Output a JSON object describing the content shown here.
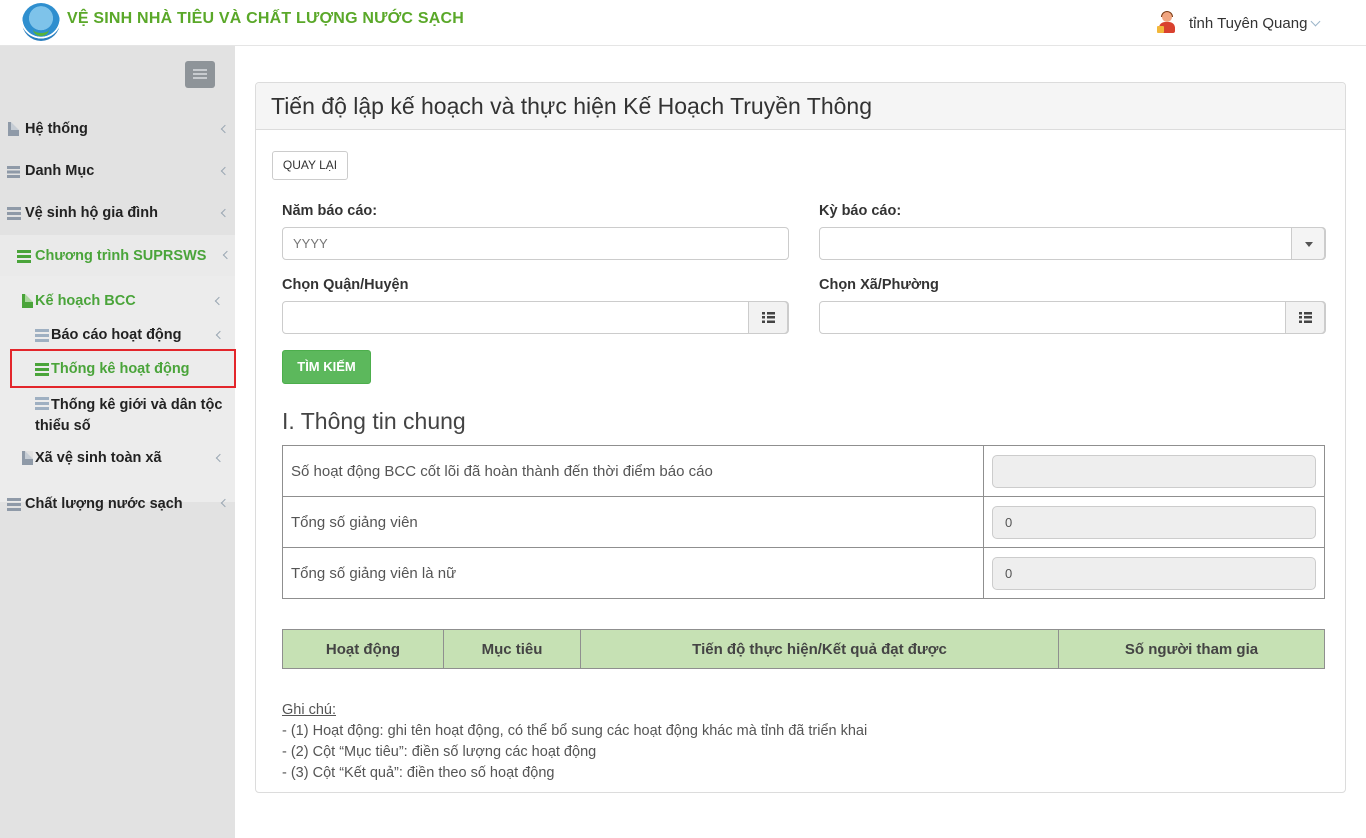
{
  "header": {
    "app_title": "VỆ SINH NHÀ TIÊU VÀ CHẤT LƯỢNG NƯỚC SẠCH",
    "user_name": "tỉnh Tuyên Quang"
  },
  "sidebar": {
    "items": [
      {
        "label": "Hệ thống"
      },
      {
        "label": "Danh Mục"
      },
      {
        "label": "Vệ sinh hộ gia đình"
      },
      {
        "label": "Chương trình SUPRSWS"
      },
      {
        "label": "Kế hoạch BCC"
      },
      {
        "label": "Báo cáo hoạt động"
      },
      {
        "label": "Thống kê hoạt động"
      },
      {
        "label": "Thống kê giới và dân tộc thiểu số"
      },
      {
        "label": "Xã vệ sinh toàn xã"
      },
      {
        "label": "Chất lượng nước sạch"
      }
    ]
  },
  "main": {
    "title": "Tiến độ lập kế hoạch và thực hiện Kế Hoạch Truyền Thông",
    "back_label": "QUAY LẠI",
    "form": {
      "year_label": "Năm báo cáo:",
      "year_placeholder": "YYYY",
      "period_label": "Kỳ báo cáo:",
      "period_value": "",
      "district_label": "Chọn Quận/Huyện",
      "district_value": "",
      "ward_label": "Chọn Xã/Phường",
      "ward_value": "",
      "search_label": "TÌM KIẾM"
    },
    "section_title": "I. Thông tin chung",
    "info_rows": [
      {
        "label": "Số hoạt động BCC cốt lõi đã hoàn thành đến thời điểm báo cáo",
        "value": ""
      },
      {
        "label": "Tổng số giảng viên",
        "value": "0"
      },
      {
        "label": "Tổng số giảng viên là nữ",
        "value": "0"
      }
    ],
    "activity_table": {
      "columns": [
        "Hoạt động",
        "Mục tiêu",
        "Tiến độ thực hiện/Kết quả đạt được",
        "Số người tham gia"
      ],
      "header_color": "#c6e1b4"
    },
    "notes": {
      "heading": "Ghi chú:",
      "lines": [
        "- (1) Hoạt động: ghi tên hoạt động, có thể bổ sung các hoạt động khác mà tỉnh đã triển khai",
        "- (2) Cột “Mục tiêu”: điền số lượng các hoạt động",
        "- (3) Cột “Kết quả”: điền theo số hoạt động"
      ]
    }
  },
  "colors": {
    "brand_green": "#5aa829",
    "button_green": "#5cb85c",
    "highlight_red": "#e3262b",
    "sidebar_bg": "#e2e2e2"
  },
  "icons": [
    "menu-icon",
    "document-icon",
    "list-icon",
    "server-icon",
    "user-avatar-icon",
    "chevron-left-icon",
    "chevron-down-icon",
    "list-addon-icon",
    "caret-down-icon"
  ]
}
